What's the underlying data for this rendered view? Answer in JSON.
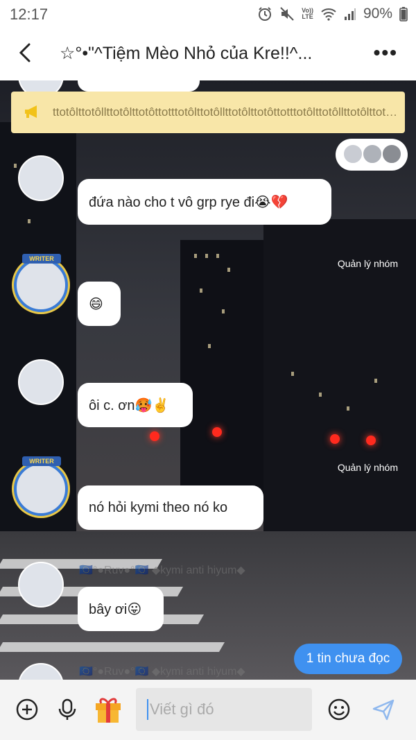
{
  "status": {
    "time": "12:17",
    "lte_line1": "Vo))",
    "lte_line2": "LTE",
    "battery": "90%"
  },
  "header": {
    "title": "☆°•\"^Tiệm Mèo Nhỏ của Kre!!^..."
  },
  "announcement": {
    "text": "ttotôlttotôllttotôlttotôttotttotôlttotôllttotôlttotôttotttotôlttotôllttotôlttotôttott"
  },
  "messages": [
    {
      "text": "đứa nào cho t vô grp rye đi😭💔"
    },
    {
      "text": "😄",
      "role": "Quản lý nhóm"
    },
    {
      "text": "ôi c. ơn🥵✌️"
    },
    {
      "text": "nó hỏi kymi theo nó ko",
      "role": "Quản lý nhóm"
    },
    {
      "text": "bây ơi😛",
      "name": "🇪🇺°●Ruv●°🇪🇺 ◆kymi anti hiyum◆"
    },
    {
      "name": "🇪🇺°●Ruv●°🇪🇺 ◆kymi anti hiyum◆"
    }
  ],
  "writer_label": "WRITER",
  "unread_badge": "1 tin chưa đọc",
  "input": {
    "placeholder": "Viết gì đó"
  },
  "colors": {
    "accent": "#3f91f0",
    "announcement_bg": "#f8e6a8",
    "frame_blue": "#3a7bd5",
    "frame_gold": "#e9c847"
  }
}
